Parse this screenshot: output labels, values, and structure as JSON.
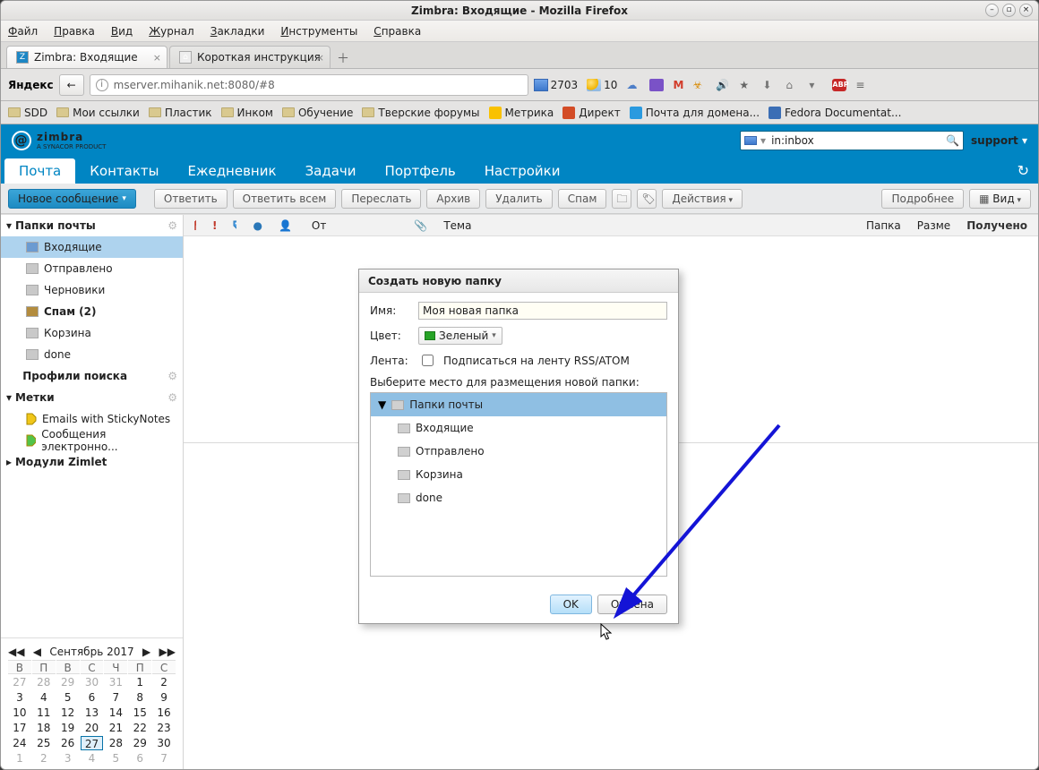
{
  "window_title": "Zimbra: Входящие - Mozilla Firefox",
  "menubar": [
    "Файл",
    "Правка",
    "Вид",
    "Журнал",
    "Закладки",
    "Инструменты",
    "Справка"
  ],
  "tabs": [
    {
      "label": "Zimbra: Входящие",
      "active": true
    },
    {
      "label": "Короткая инструкция",
      "active": false
    }
  ],
  "yandex_label": "Яндекс",
  "url": "mserver.mihanik.net:8080/#8",
  "mail_badge": "2703",
  "weather": "10",
  "bookmarks": [
    "SDD",
    "Мои ссылки",
    "Пластик",
    "Инком",
    "Обучение",
    "Тверские форумы"
  ],
  "bookmarks_iconed": [
    {
      "label": "Метрика"
    },
    {
      "label": "Директ"
    },
    {
      "label": "Почта для домена..."
    },
    {
      "label": "Fedora Documentat..."
    }
  ],
  "brand": "zimbra",
  "brand_sub": "A SYNACOR PRODUCT",
  "search_prefix": "in:inbox",
  "support": "support",
  "app_tabs": [
    "Почта",
    "Контакты",
    "Ежедневник",
    "Задачи",
    "Портфель",
    "Настройки"
  ],
  "compose": "Новое сообщение",
  "toolbar": {
    "reply": "Ответить",
    "reply_all": "Ответить всем",
    "forward": "Переслать",
    "archive": "Архив",
    "delete": "Удалить",
    "spam": "Спам",
    "actions": "Действия",
    "more": "Подробнее",
    "view": "Вид"
  },
  "sidebar": {
    "mail_header": "Папки почты",
    "folders": [
      {
        "label": "Входящие",
        "icon": "inbox",
        "selected": true
      },
      {
        "label": "Отправлено",
        "icon": "sent"
      },
      {
        "label": "Черновики",
        "icon": "draft"
      },
      {
        "label": "Спам (2)",
        "icon": "spam",
        "bold": true
      },
      {
        "label": "Корзина",
        "icon": "trash"
      },
      {
        "label": "done",
        "icon": "folder"
      }
    ],
    "search_header": "Профили поиска",
    "tags_header": "Метки",
    "tags": [
      "Emails with StickyNotes",
      "Сообщения электронно..."
    ],
    "zimlets": "Модули Zimlet"
  },
  "list_columns": {
    "from": "От",
    "subject": "Тема",
    "folder": "Папка",
    "size": "Разме",
    "received": "Получено"
  },
  "calendar": {
    "month": "Сентябрь 2017",
    "days": [
      "В",
      "П",
      "В",
      "С",
      "Ч",
      "П",
      "С"
    ],
    "rows": [
      [
        "27",
        "28",
        "29",
        "30",
        "31",
        "1",
        "2"
      ],
      [
        "3",
        "4",
        "5",
        "6",
        "7",
        "8",
        "9"
      ],
      [
        "10",
        "11",
        "12",
        "13",
        "14",
        "15",
        "16"
      ],
      [
        "17",
        "18",
        "19",
        "20",
        "21",
        "22",
        "23"
      ],
      [
        "24",
        "25",
        "26",
        "27",
        "28",
        "29",
        "30"
      ],
      [
        "1",
        "2",
        "3",
        "4",
        "5",
        "6",
        "7"
      ]
    ],
    "today": "27"
  },
  "dialog": {
    "title": "Создать новую папку",
    "name_label": "Имя:",
    "name_value": "Моя новая папка",
    "color_label": "Цвет:",
    "color_value": "Зеленый",
    "feed_label": "Лента:",
    "feed_text": "Подписаться на ленту RSS/ATOM",
    "location": "Выберите место для размещения новой папки:",
    "tree": [
      {
        "label": "Папки почты",
        "root": true
      },
      {
        "label": "Входящие"
      },
      {
        "label": "Отправлено"
      },
      {
        "label": "Корзина"
      },
      {
        "label": "done"
      }
    ],
    "ok": "OK",
    "cancel": "Отмена"
  }
}
